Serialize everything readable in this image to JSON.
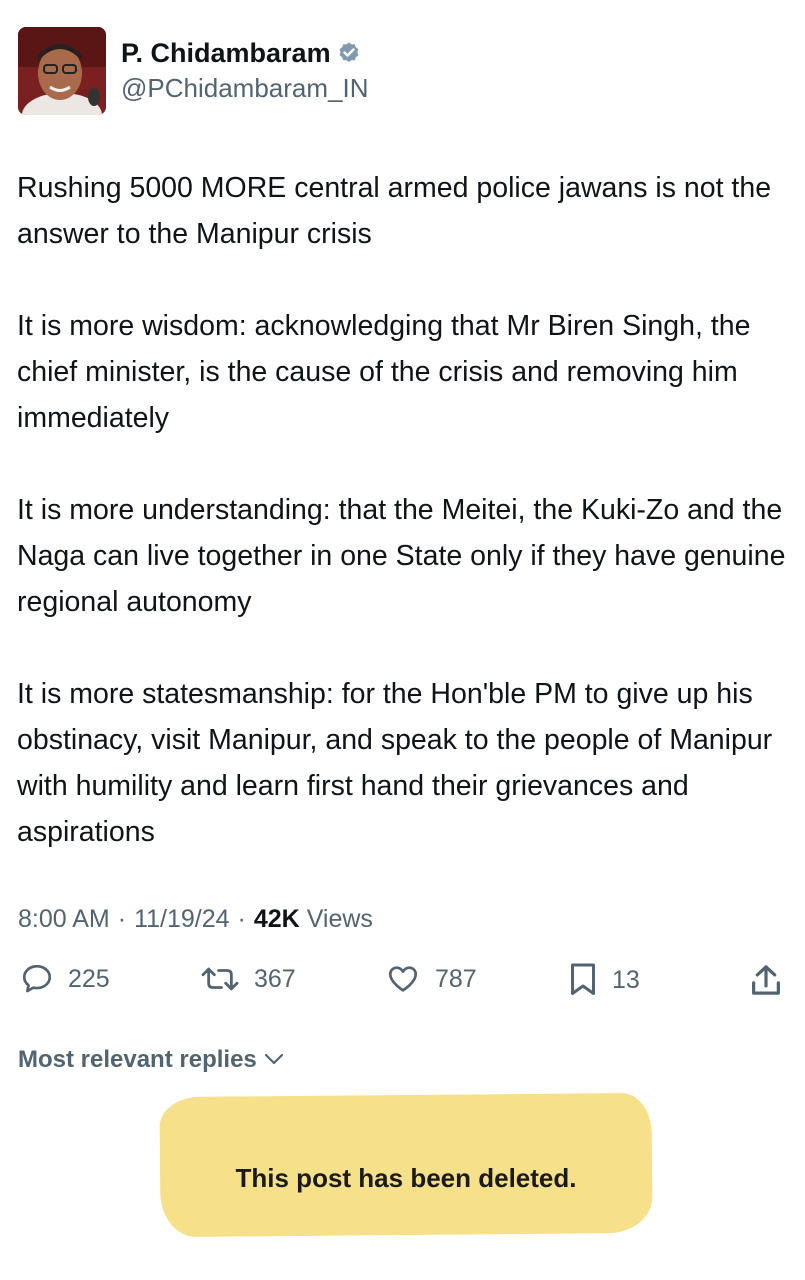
{
  "author": {
    "display_name": "P. Chidambaram",
    "handle": "@PChidambaram_IN",
    "verified": true
  },
  "tweet": {
    "paragraphs": [
      "Rushing 5000 MORE central armed police jawans is not the answer to the Manipur crisis",
      "It is more wisdom: acknowledging that Mr Biren Singh, the chief minister, is the cause of the crisis and removing him immediately",
      "It is more understanding: that the Meitei, the Kuki-Zo and the Naga can live together in one State only if they have genuine regional autonomy",
      "It is more statesmanship: for the Hon'ble PM to give up his obstinacy, visit Manipur, and speak to the people of Manipur with humility and learn first hand their grievances and aspirations"
    ]
  },
  "meta": {
    "time": "8:00 AM",
    "date": "11/19/24",
    "views_count": "42K",
    "views_label": "Views",
    "separator": "·"
  },
  "actions": {
    "replies": "225",
    "reposts": "367",
    "likes": "787",
    "bookmarks": "13"
  },
  "replies_sort": {
    "label": "Most relevant replies"
  },
  "deleted_notice": {
    "text": "This post has been deleted."
  },
  "colors": {
    "text_primary": "#0f1419",
    "text_secondary": "#536471",
    "verified_badge": "#829aab",
    "highlight": "#f6e089"
  },
  "icons": {
    "reply": "reply-icon",
    "repost": "repost-icon",
    "like": "heart-icon",
    "bookmark": "bookmark-icon",
    "share": "share-icon",
    "verified": "verified-badge-icon",
    "chevron": "chevron-down-icon"
  }
}
